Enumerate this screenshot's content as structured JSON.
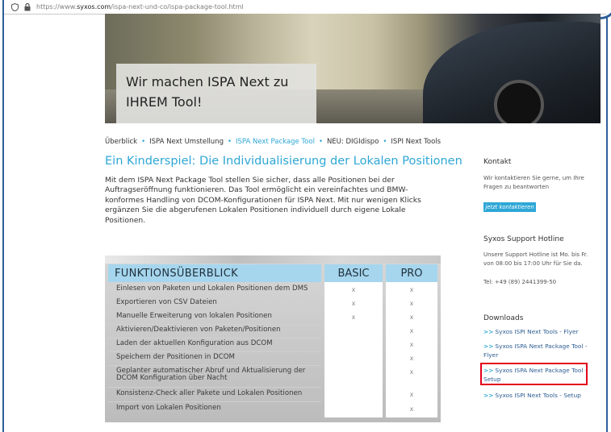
{
  "browser": {
    "url_prefix": "https://www.",
    "url_domain": "syxos.com",
    "url_path": "/ispa-next-und-co/ispa-package-tool.html"
  },
  "hero": {
    "caption": "Wir machen ISPA Next zu IHREM Tool!"
  },
  "breadcrumb": {
    "items": [
      "Überblick",
      "ISPA Next Umstellung",
      "ISPA Next Package Tool",
      "NEU: DIGIdispo",
      "ISPI Next Tools"
    ],
    "separator": "•"
  },
  "main": {
    "heading": "Ein Kinderspiel: Die Individualisierung der Lokalen Positionen",
    "intro": "Mit dem ISPA Next Package Tool stellen Sie sicher, dass alle Positionen bei der Auftragseröffnung funktionieren. Das Tool ermöglicht ein vereinfachtes und BMW-konformes Handling von DCOM-Konfigurationen für ISPA Next. Mit nur wenigen Klicks ergänzen Sie die abgerufenen Lokalen Positionen individuell durch eigene Lokale Positionen."
  },
  "table": {
    "headers": {
      "feature": "FUNKTIONSÜBERBLICK",
      "basic": "BASIC",
      "pro": "PRO"
    },
    "rows": [
      {
        "label": "Einlesen von Paketen und Lokalen Positionen dem DMS",
        "basic": "x",
        "pro": "x"
      },
      {
        "label": "Exportieren von CSV Dateien",
        "basic": "x",
        "pro": "x"
      },
      {
        "label": "Manuelle Erweiterung von lokalen Positionen",
        "basic": "x",
        "pro": "x"
      },
      {
        "label": "Aktivieren/Deaktivieren von Paketen/Positionen",
        "basic": "",
        "pro": "x"
      },
      {
        "label": "Laden der aktuellen Konfiguration aus DCOM",
        "basic": "",
        "pro": "x"
      },
      {
        "label": "Speichern der Positionen in DCOM",
        "basic": "",
        "pro": "x"
      },
      {
        "label": "Geplanter automatischer Abruf und Aktualisierung der DCOM Konfiguration über Nacht",
        "basic": "",
        "pro": "x"
      },
      {
        "label": "Konsistenz-Check aller Pakete und Lokalen Positionen",
        "basic": "",
        "pro": "x"
      },
      {
        "label": "Import von Lokalen Positionen",
        "basic": "",
        "pro": "x"
      }
    ]
  },
  "sidebar": {
    "contact_title": "Kontakt",
    "contact_text": "Wir kontaktieren Sie gerne, um Ihre Fragen zu beantworten",
    "contact_button": "jetzt kontaktieren",
    "hotline_title": "Syxos Support Hotline",
    "hotline_text": "Unsere Support Hotline ist Mo. bis Fr. von 08:00 bis 17:00 Uhr für Sie da.",
    "hotline_phone": "Tel: +49 (89) 2441399-50",
    "downloads_title": "Downloads",
    "downloads": [
      {
        "arrow": ">>",
        "label": "Syxos ISPI Next Tools - Flyer"
      },
      {
        "arrow": ">>",
        "label": "Syxos ISPA Next Package Tool - Flyer"
      },
      {
        "arrow": ">>",
        "label": "Syxos ISPA Next Package Tool - Setup"
      },
      {
        "arrow": ">>",
        "label": "Syxos ISPI Next Tools - Setup"
      }
    ]
  },
  "colors": {
    "accent": "#2ea7d6",
    "frame": "#2f5f9a",
    "highlight": "#e2001a",
    "table_header": "#a6d6ee"
  }
}
